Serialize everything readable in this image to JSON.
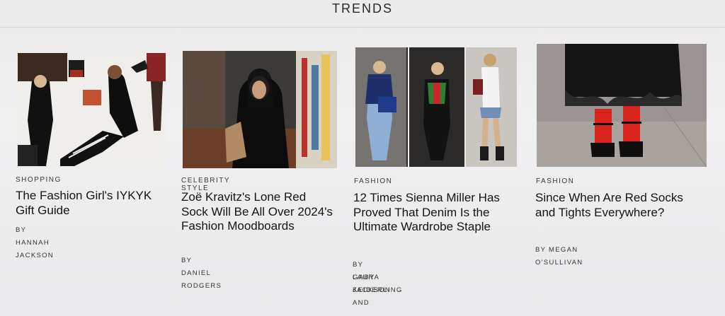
{
  "section": {
    "title": "TRENDS"
  },
  "cards": [
    {
      "tag": "SHOPPING",
      "headline": "The Fashion Girl's IYKYK Gift Guide",
      "byline_1": "BY HANNAH JACKSON",
      "byline_2": ""
    },
    {
      "tag": "CELEBRITY STYLE",
      "headline": "Zoë Kravitz's Lone Red Sock Will Be All Over 2024's Fashion Moodboards",
      "byline_1": "BY DANIEL RODGERS",
      "byline_2": ""
    },
    {
      "tag": "FASHION",
      "headline": "12 Times Sienna Miller Has Proved That Denim Is the Ultimate Wardrobe Staple",
      "byline_1": "BY LAURA JACKSON AND",
      "byline_2": "GABY KEIDERLING"
    },
    {
      "tag": "FASHION",
      "headline": "Since When Are Red Socks and Tights Everywhere?",
      "byline_1": "BY MEGAN O'SULLIVAN",
      "byline_2": ""
    }
  ]
}
